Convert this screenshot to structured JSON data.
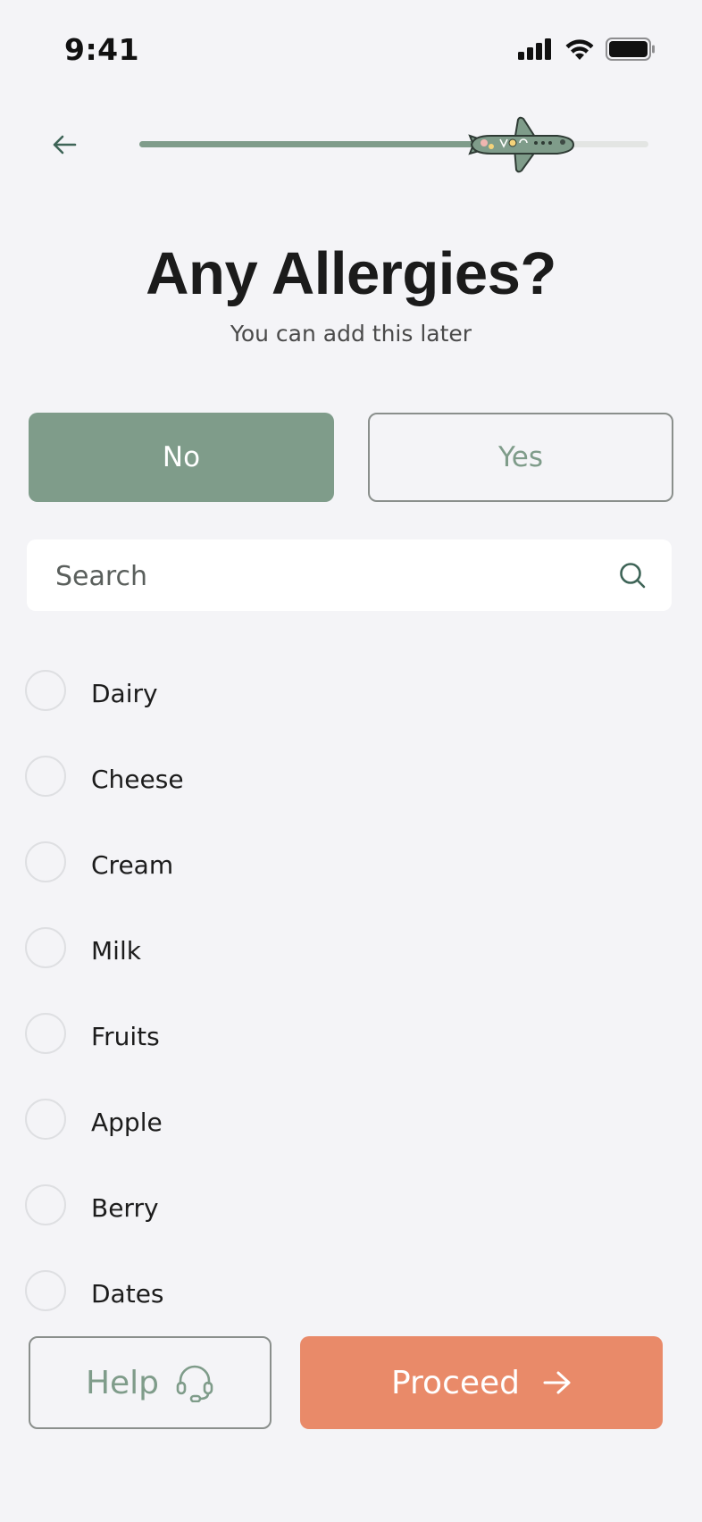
{
  "status_bar": {
    "time": "9:41"
  },
  "header": {
    "back_icon": "arrow-left-icon",
    "progress": 0.7
  },
  "title": "Any Allergies?",
  "subtitle": "You can add this later",
  "toggle": {
    "no_label": "No",
    "yes_label": "Yes",
    "selected": "No"
  },
  "search": {
    "placeholder": "Search",
    "value": ""
  },
  "allergies": [
    {
      "label": "Dairy",
      "checked": false
    },
    {
      "label": "Cheese",
      "checked": false
    },
    {
      "label": "Cream",
      "checked": false
    },
    {
      "label": "Milk",
      "checked": false
    },
    {
      "label": "Fruits",
      "checked": false
    },
    {
      "label": "Apple",
      "checked": false
    },
    {
      "label": "Berry",
      "checked": false
    },
    {
      "label": "Dates",
      "checked": false
    }
  ],
  "footer": {
    "help_label": "Help",
    "help_icon": "headset-icon",
    "proceed_label": "Proceed",
    "proceed_icon": "arrow-right-icon"
  },
  "colors": {
    "accent_green": "#7f9c8a",
    "proceed_orange": "#e98a69",
    "background": "#f4f4f7"
  }
}
